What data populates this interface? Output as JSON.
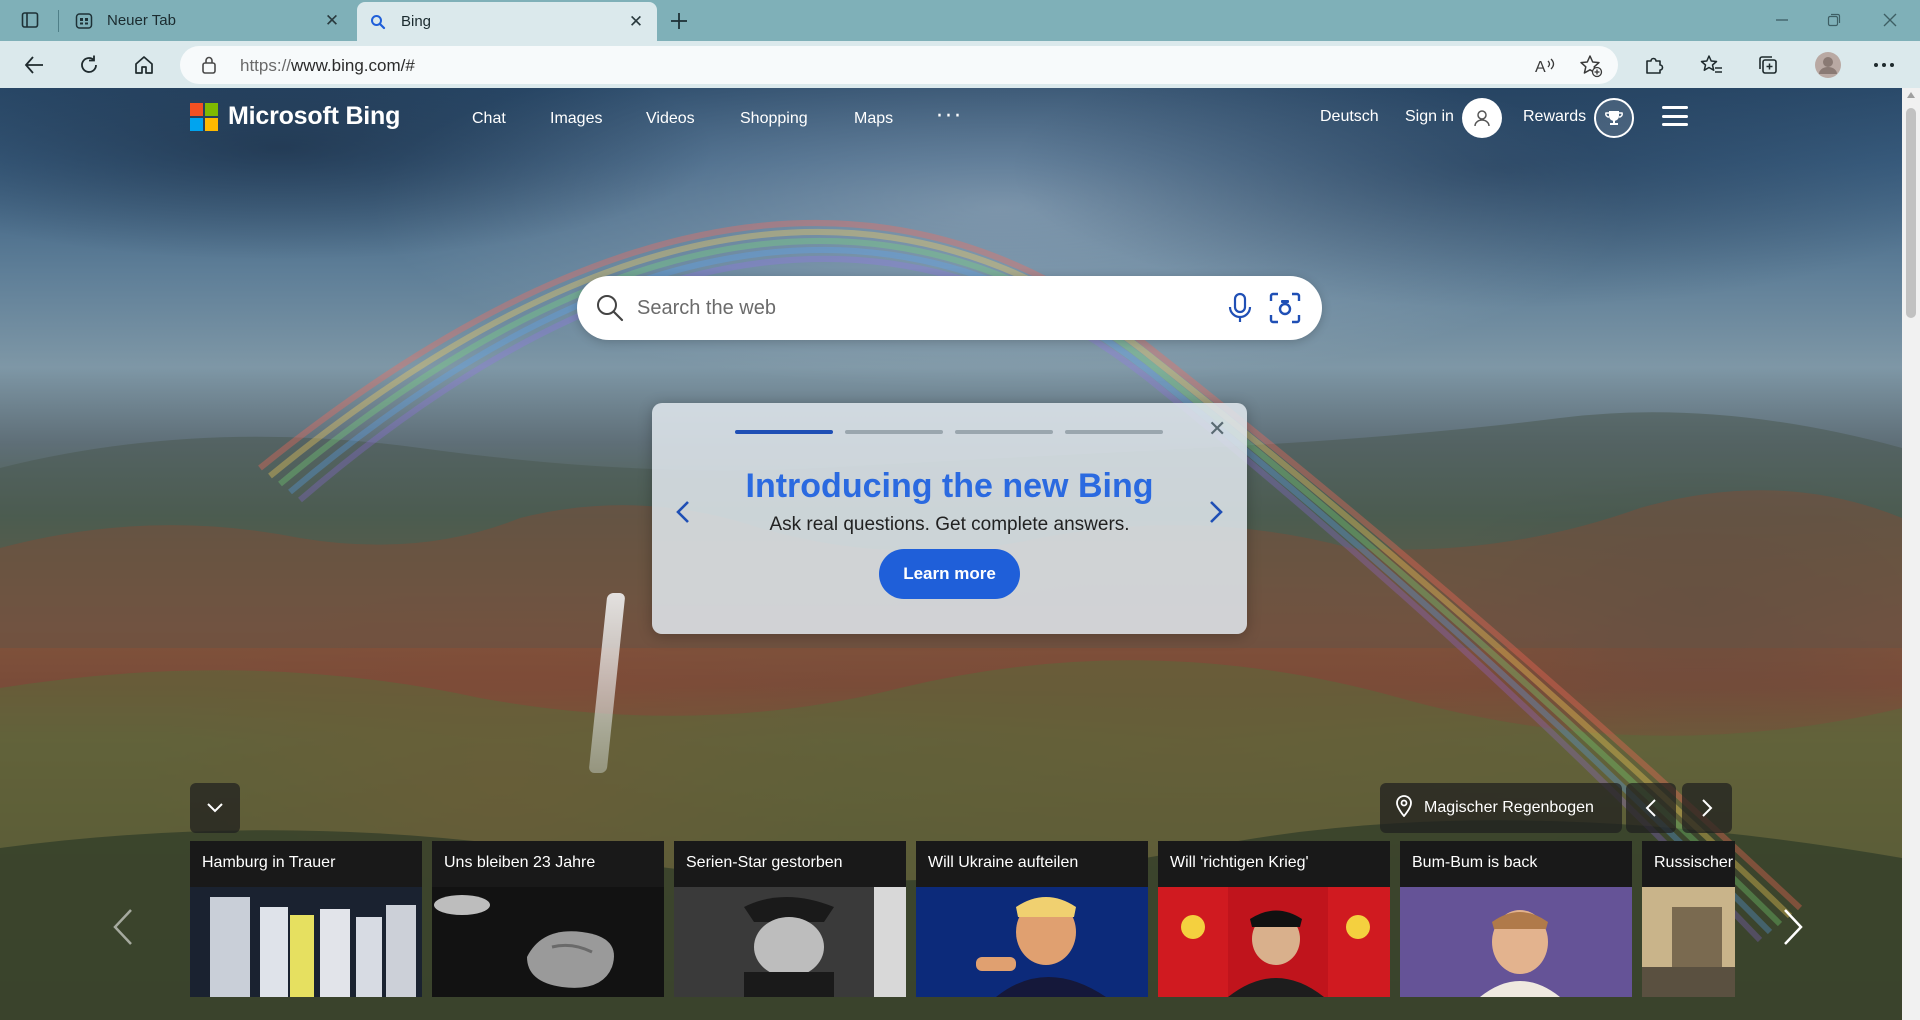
{
  "browser": {
    "tabs": [
      {
        "title": "Neuer Tab",
        "favicon": "newtab-icon"
      },
      {
        "title": "Bing",
        "favicon": "bing-search-icon"
      }
    ],
    "address_bar": {
      "scheme": "https://",
      "host_path": "www.bing.com/#"
    }
  },
  "header": {
    "logo_text": "Microsoft Bing",
    "nav": [
      "Chat",
      "Images",
      "Videos",
      "Shopping",
      "Maps"
    ],
    "more": "···",
    "language": "Deutsch",
    "sign_in": "Sign in",
    "rewards": "Rewards"
  },
  "search": {
    "placeholder": "Search the web"
  },
  "promo": {
    "title": "Introducing the new Bing",
    "subtitle": "Ask real questions. Get complete answers.",
    "button": "Learn more",
    "active_slide": 1,
    "slide_count": 4
  },
  "image_info": {
    "location_label": "Magischer Regenbogen"
  },
  "news": [
    {
      "headline": "Hamburg in Trauer"
    },
    {
      "headline": "Uns bleiben 23 Jahre"
    },
    {
      "headline": "Serien-Star gestorben"
    },
    {
      "headline": "Will Ukraine aufteilen"
    },
    {
      "headline": "Will 'richtigen Krieg'"
    },
    {
      "headline": "Bum-Bum is back"
    },
    {
      "headline": "Russischer"
    }
  ],
  "colors": {
    "accent_blue": "#2b6ae0",
    "button_blue": "#1f5fd9",
    "ms_red": "#f25022",
    "ms_green": "#7fba00",
    "ms_blue": "#00a4ef",
    "ms_yellow": "#ffb900"
  }
}
